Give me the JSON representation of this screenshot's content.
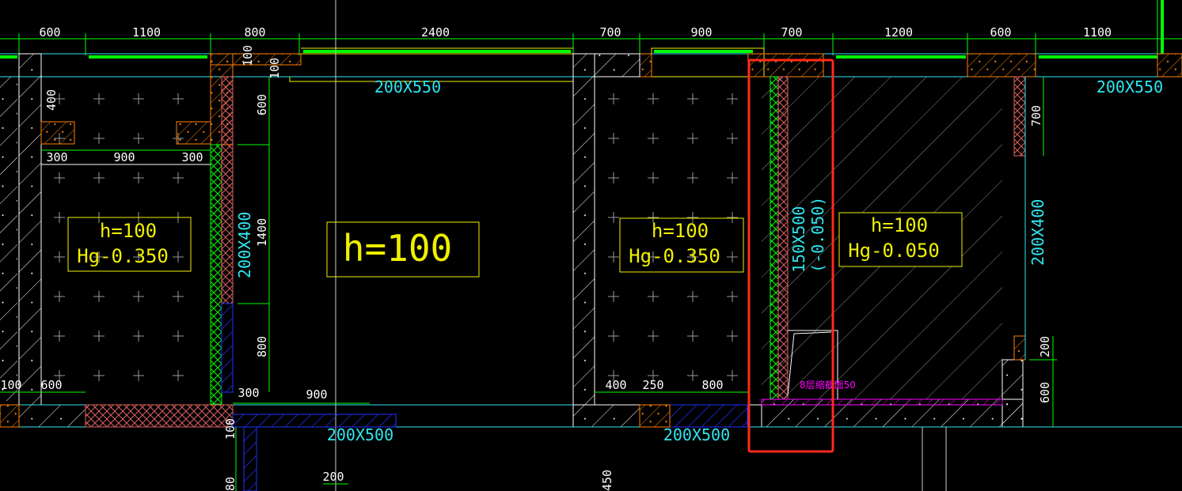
{
  "colors": {
    "background": "#000000",
    "dimension": "#00ff00",
    "beam_label": "#2fe6f0",
    "room_label": "#f0f000",
    "wall": "#ffffff",
    "highlight": "#ff2a1a",
    "note": "#ff00ff",
    "masonry": "#ff8000"
  },
  "top_dimensions": [
    "600",
    "1100",
    "800",
    "2400",
    "700",
    "900",
    "700",
    "1200",
    "600",
    "1100"
  ],
  "beams": {
    "top_mid": "200X550",
    "top_right": "200X550",
    "left_vertical": "200X400",
    "right_vertical": "200X400",
    "bottom_left": "200X500",
    "bottom_mid": "200X500",
    "highlight_vertical": "150X500",
    "highlight_elev": "(-0.050)"
  },
  "rooms": [
    {
      "h": "h=100",
      "hg": "Hg-0.350"
    },
    {
      "h": "h=100",
      "hg": ""
    },
    {
      "h": "h=100",
      "hg": "Hg-0.350"
    },
    {
      "h": "h=100",
      "hg": "Hg-0.050"
    }
  ],
  "small_dims": {
    "left_400": "400",
    "left_300a": "300",
    "left_900": "900",
    "left_300b": "300",
    "v_100a": "100",
    "v_100b": "100",
    "v_600": "600",
    "v_1400": "1400",
    "v_800": "800",
    "b_100": "100",
    "b_600": "600",
    "b_300": "300",
    "b_900": "900",
    "b_100v": "100",
    "b_200": "200",
    "b_80": "80",
    "m_400": "400",
    "m_250": "250",
    "m_800": "800",
    "m_450": "450",
    "r_700": "700",
    "r_200": "200",
    "r_600": "600"
  },
  "note": "8层缩截面50"
}
